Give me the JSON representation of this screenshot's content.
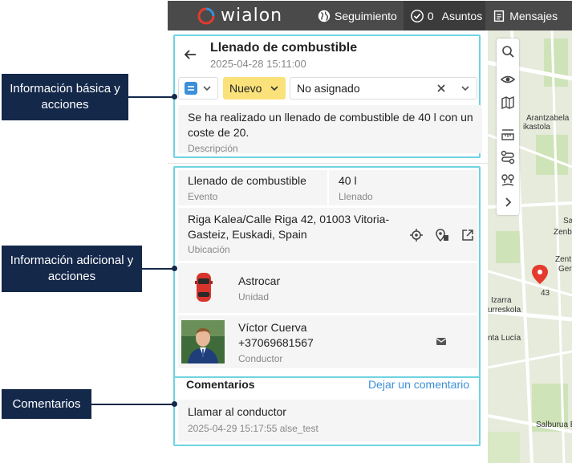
{
  "topbar": {
    "brand": "wialon",
    "nav": [
      {
        "label": "Seguimiento",
        "icon": "globe-icon"
      },
      {
        "label": "0",
        "icon": "check-circle-icon"
      },
      {
        "label": "Asuntos",
        "icon": "issues"
      },
      {
        "label": "Mensajes",
        "icon": "messages-icon"
      }
    ]
  },
  "event": {
    "title": "Llenado de combustible",
    "datetime": "2025-04-28 15:11:00",
    "status": "Nuevo",
    "assignee": "No asignado",
    "description": "Se ha realizado un llenado de combustible de 40 l con un coste de 20.",
    "description_label": "Descripción"
  },
  "details": {
    "event_value": "Llenado de combustible",
    "event_label": "Evento",
    "fill_value": "40 l",
    "fill_label": "Llenado",
    "location_value": "Riga Kalea/Calle Riga 42, 01003 Vitoria-Gasteiz, Euskadi, Spain",
    "location_label": "Ubicación",
    "unit_value": "Astrocar",
    "unit_label": "Unidad",
    "driver_name": "Víctor Cuerva",
    "driver_phone": "+37069681567",
    "driver_label": "Conductor"
  },
  "comments": {
    "header": "Comentarios",
    "add_link": "Dejar un comentario",
    "items": [
      {
        "text": "Llamar al conductor",
        "meta": "2025-04-29 15:17:55 alse_test"
      }
    ]
  },
  "callouts": {
    "basic": "Información básica y acciones",
    "additional": "Información adicional y acciones",
    "comments": "Comentarios"
  },
  "map": {
    "labels": [
      "Arantzabela",
      "ikastola",
      "Zenb",
      "43",
      "Izarra",
      "urreskola",
      "nta Lucía",
      "Salburua Bk",
      "Zent",
      "Ger",
      "Sa"
    ]
  },
  "colors": {
    "highlight_border": "#6fd3e0",
    "callout_bg": "#14284a",
    "status_bg": "#fbe17a",
    "link": "#3c8fd8",
    "topbar_bg": "#4a4a4a"
  }
}
